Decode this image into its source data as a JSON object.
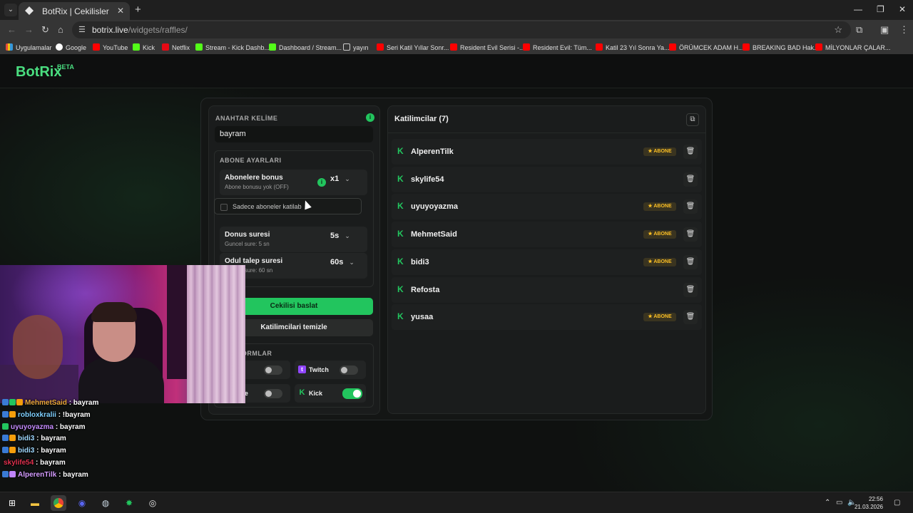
{
  "browser": {
    "tab_title": "BotRix | Cekilisler",
    "url_domain": "botrix.live",
    "url_path": "/widgets/raffles/",
    "bookmarks": [
      {
        "label": "Uygulamalar",
        "icon": "apps-grid-icon",
        "color": "#ffffff"
      },
      {
        "label": "Google",
        "icon": "google-icon",
        "color": "#ffffff"
      },
      {
        "label": "YouTube",
        "icon": "youtube-icon",
        "color": "#ff0000"
      },
      {
        "label": "Kick",
        "icon": "kick-icon",
        "color": "#53fc18"
      },
      {
        "label": "Netflix",
        "icon": "netflix-icon",
        "color": "#e50914"
      },
      {
        "label": "Stream - Kick Dashb...",
        "icon": "kick-icon",
        "color": "#53fc18"
      },
      {
        "label": "Dashboard / Stream...",
        "icon": "dashboard-icon",
        "color": "#53fc18"
      },
      {
        "label": "yayın",
        "icon": "folder-icon",
        "color": "#cccccc"
      },
      {
        "label": "Seri Katil Yıllar Sonr...",
        "icon": "youtube-icon",
        "color": "#ff0000"
      },
      {
        "label": "Resident Evil Serisi -...",
        "icon": "youtube-icon",
        "color": "#ff0000"
      },
      {
        "label": "Resident Evil: Tüm...",
        "icon": "youtube-icon",
        "color": "#ff0000"
      },
      {
        "label": "Katil 23 Yıl Sonra Ya...",
        "icon": "youtube-icon",
        "color": "#ff0000"
      },
      {
        "label": "ÖRÜMCEK ADAM H...",
        "icon": "youtube-icon",
        "color": "#ff0000"
      },
      {
        "label": "BREAKING BAD Hak...",
        "icon": "youtube-icon",
        "color": "#ff0000"
      },
      {
        "label": "MİLYONLAR ÇALAR...",
        "icon": "youtube-icon",
        "color": "#ff0000"
      }
    ]
  },
  "app": {
    "logo": "BotRix",
    "logo_badge": "BETA",
    "accent": "#22c55e"
  },
  "raffle": {
    "keyword_label": "ANAHTAR KELİME",
    "keyword_value": "bayram",
    "sub_settings_label": "ABONE AYARLARI",
    "sub_bonus": {
      "title": "Abonelere bonus",
      "subtitle": "Abone bonusu yok (OFF)",
      "value": "x1"
    },
    "only_subs_label": "Sadece aboneler katilab",
    "donus": {
      "title": "Donus suresi",
      "subtitle": "Guncel sure: 5 sn",
      "value": "5s"
    },
    "odul": {
      "title": "Odul talep suresi",
      "subtitle": "Guncel sure: 60 sn",
      "value": "60s"
    },
    "start_button": "Cekilisi baslat",
    "clear_button": "Katilimcilari temizle",
    "platforms_label": "PLATFORMLAR",
    "platforms": [
      {
        "name": "Trovo",
        "visible_name": "vo",
        "on": false
      },
      {
        "name": "Twitch",
        "visible_name": "Twitch",
        "on": false
      },
      {
        "name": "YouTube",
        "visible_name": "Tube",
        "on": false
      },
      {
        "name": "Kick",
        "visible_name": "Kick",
        "on": true
      }
    ]
  },
  "participants": {
    "title": "Katilimcilar (7)",
    "badge_label": "ABONE",
    "items": [
      {
        "name": "AlperenTilk",
        "subscriber": true
      },
      {
        "name": "skylife54",
        "subscriber": false
      },
      {
        "name": "uyuyoyazma",
        "subscriber": true
      },
      {
        "name": "MehmetSaid",
        "subscriber": true
      },
      {
        "name": "bidi3",
        "subscriber": true
      },
      {
        "name": "Refosta",
        "subscriber": false
      },
      {
        "name": "yusaa",
        "subscriber": true
      }
    ]
  },
  "chat": [
    {
      "user": "MehmetSaid",
      "message": ": bayram",
      "color": "#e8a73a"
    },
    {
      "user": "robloxkralii",
      "message": ": !bayram",
      "color": "#7fd0ff"
    },
    {
      "user": "uyuyoyazma",
      "message": ": bayram",
      "color": "#c68cff"
    },
    {
      "user": "bidi3",
      "message": ": bayram",
      "color": "#9fd8ff"
    },
    {
      "user": "bidi3",
      "message": ": bayram",
      "color": "#9fd8ff"
    },
    {
      "user": "skylife54",
      "message": ": bayram",
      "color": "#e0314e"
    },
    {
      "user": "AlperenTilk",
      "message": ": bayram",
      "color": "#d49cff"
    }
  ],
  "taskbar": {
    "time": "22:56",
    "date": "21.03.2026"
  }
}
